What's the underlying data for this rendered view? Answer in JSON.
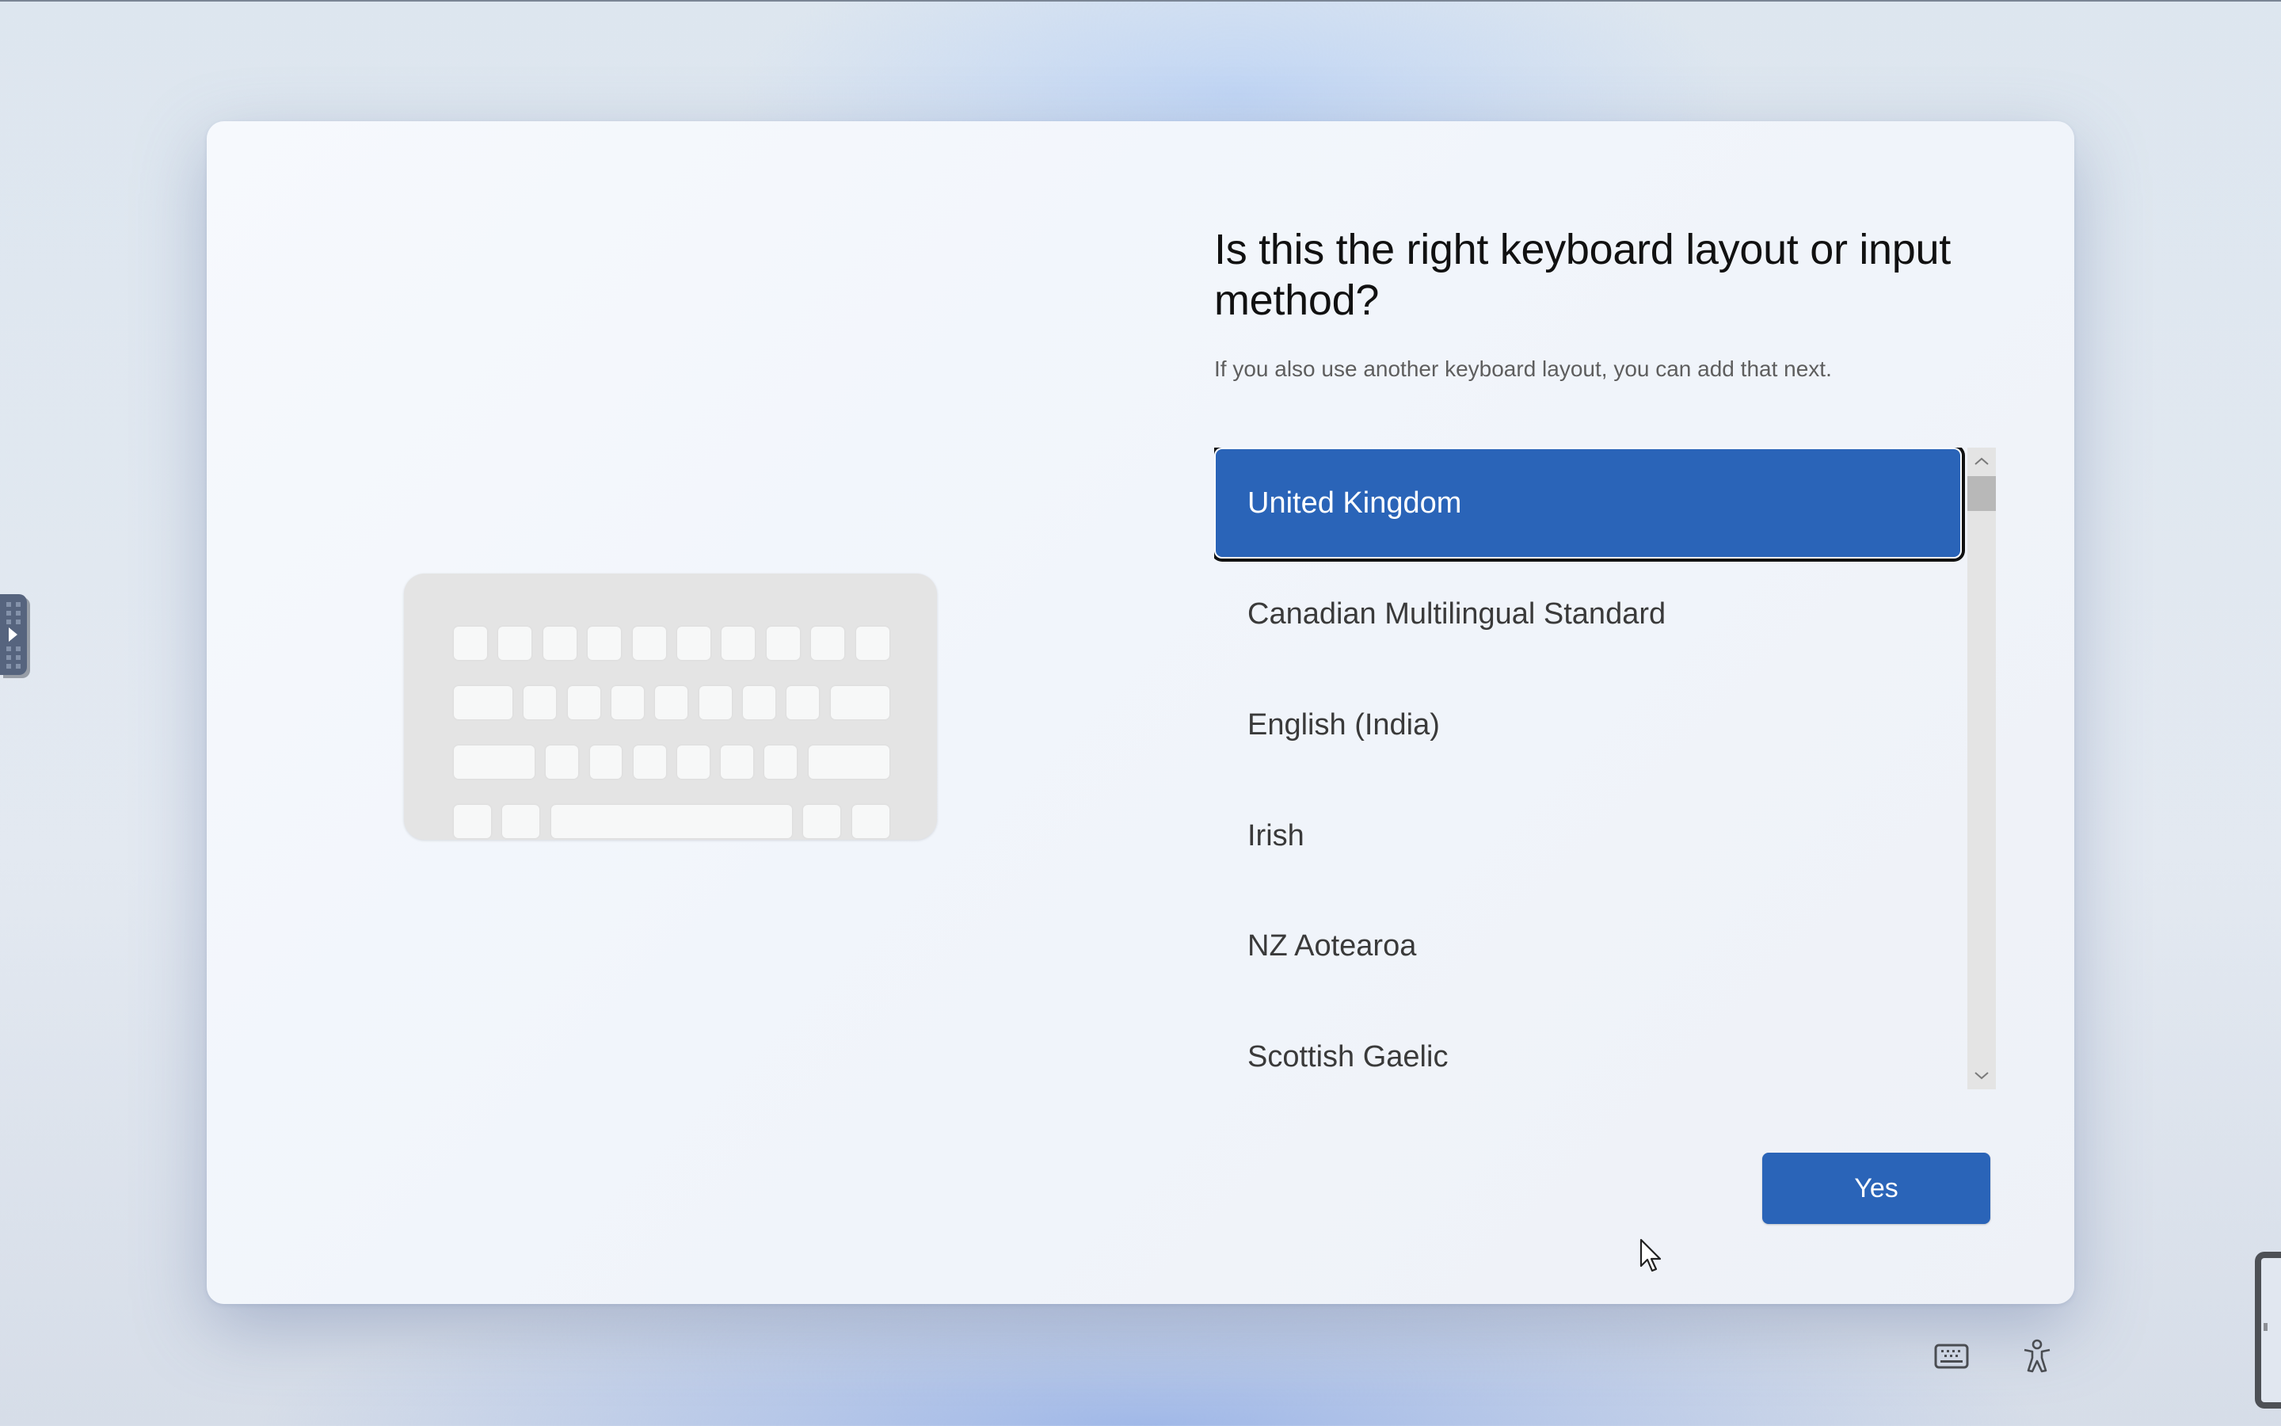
{
  "dialog": {
    "heading": "Is this the right keyboard layout or input method?",
    "subtitle": "If you also use another keyboard layout, you can add that next."
  },
  "layout_list": {
    "selected_index": 0,
    "items": [
      {
        "label": "United Kingdom",
        "selected": true
      },
      {
        "label": "Canadian Multilingual Standard",
        "selected": false
      },
      {
        "label": "English (India)",
        "selected": false
      },
      {
        "label": "Irish",
        "selected": false
      },
      {
        "label": "NZ Aotearoa",
        "selected": false
      },
      {
        "label": "Scottish Gaelic",
        "selected": false
      }
    ],
    "scroll_up_glyph": "⌃",
    "scroll_down_glyph": "⌄"
  },
  "actions": {
    "yes_label": "Yes"
  },
  "footer_icons": [
    {
      "name": "keyboard-icon"
    },
    {
      "name": "accessibility-icon"
    }
  ],
  "colors": {
    "accent": "#2a64b8",
    "selected_text": "#ffffff",
    "item_text": "#3a3a3a",
    "subtitle_text": "#5e5e5e"
  }
}
